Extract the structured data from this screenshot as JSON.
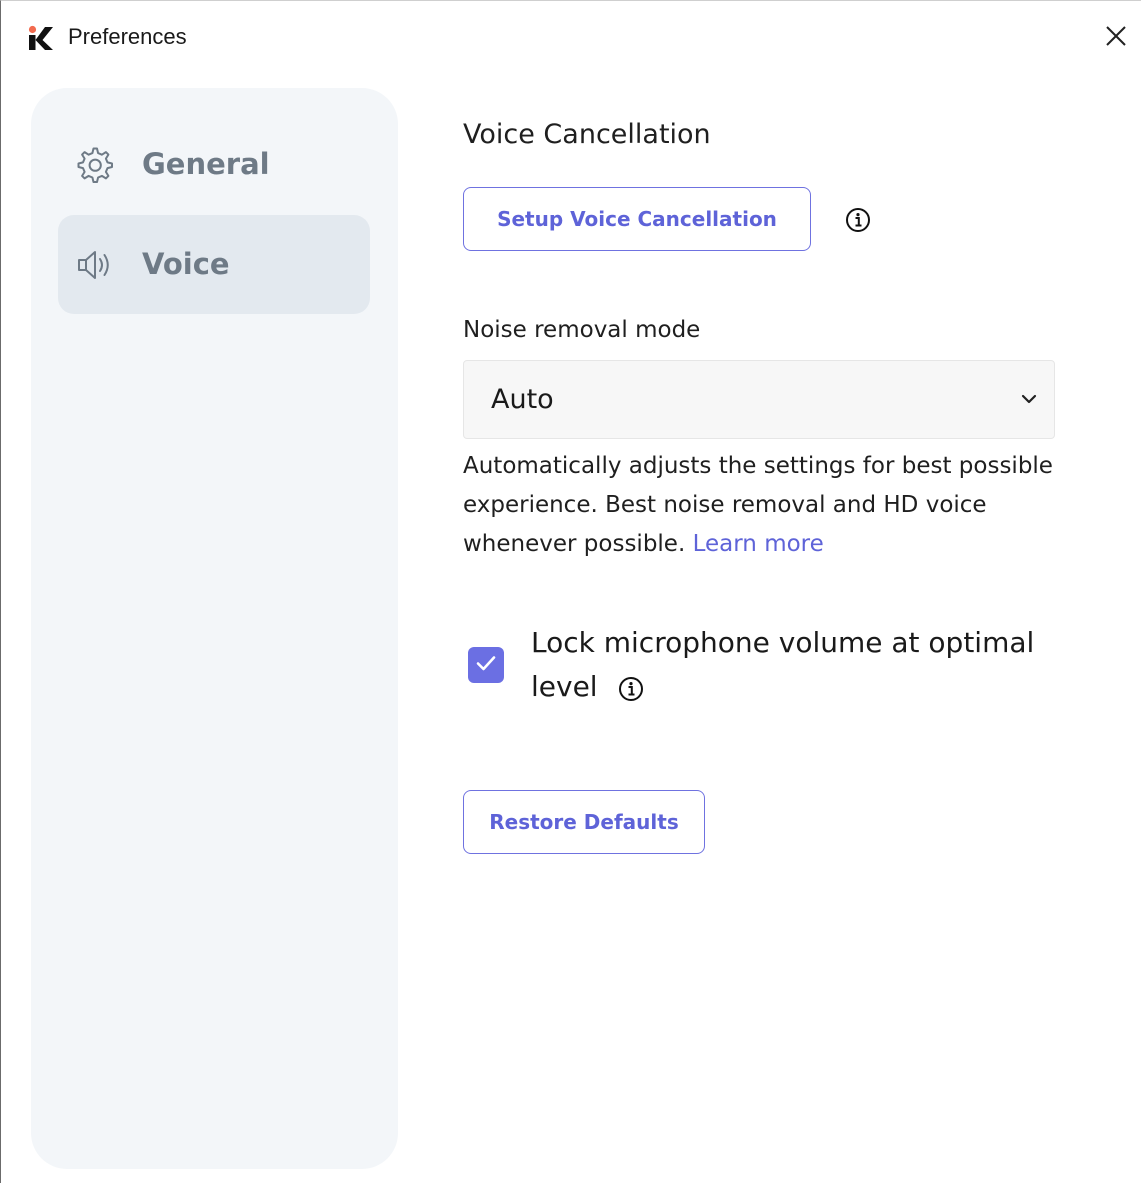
{
  "window": {
    "title": "Preferences",
    "logo_icon": "kr-logo-icon",
    "close_icon": "close-icon"
  },
  "sidebar": {
    "items": [
      {
        "label": "General",
        "icon": "gear-icon",
        "active": false
      },
      {
        "label": "Voice",
        "icon": "speaker-icon",
        "active": true
      }
    ]
  },
  "main": {
    "section_title": "Voice Cancellation",
    "setup_button_label": "Setup Voice Cancellation",
    "noise_mode_label": "Noise removal mode",
    "noise_mode_value": "Auto",
    "description": "Automatically adjusts the settings for best possible experience. Best noise removal and HD voice whenever possible.",
    "learn_more_label": "Learn more",
    "lock_mic_label_line1": "Lock microphone volume at optimal",
    "lock_mic_label_line2": "level",
    "lock_mic_checked": true,
    "restore_button_label": "Restore Defaults"
  },
  "colors": {
    "accent": "#5e63d8",
    "checkbox": "#6b6fe3",
    "sidebar_bg": "#f3f6f9",
    "sidebar_active": "#e3e9ef",
    "sidebar_text": "#6e7a86",
    "logo_dot": "#f26b4f"
  }
}
